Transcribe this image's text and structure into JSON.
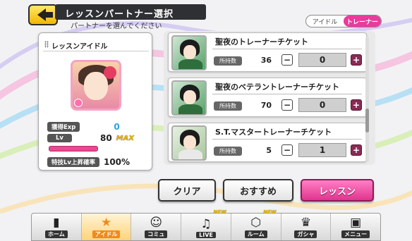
{
  "header": {
    "title": "レッスンパートナー選択",
    "subtitle": "パートナーを選んでください"
  },
  "toggle": {
    "idol_label": "アイドル",
    "trainer_label": "トレーナー",
    "selected": "トレーナー"
  },
  "lesson_idol": {
    "panel_title": "レッスンアイドル",
    "exp_label": "獲得Exp",
    "exp_value": "0",
    "lv_label": "Lv",
    "lv_value": "80",
    "max_label": "MAX",
    "rate_label": "特技Lv上昇確率",
    "rate_value": "100%"
  },
  "tickets": [
    {
      "name": "聖夜のトレーナーチケット",
      "hold_label": "所持数",
      "hold_count": "36",
      "quantity": "0"
    },
    {
      "name": "聖夜のベテラントレーナーチケット",
      "hold_label": "所持数",
      "hold_count": "70",
      "quantity": "0"
    },
    {
      "name": "S.T.マスタートレーナーチケット",
      "hold_label": "所持数",
      "hold_count": "5",
      "quantity": "1"
    }
  ],
  "actions": {
    "clear_label": "クリア",
    "recommend_label": "おすすめ",
    "lesson_label": "レッスン"
  },
  "nav": [
    {
      "label": "ホーム",
      "icon": "home-icon",
      "glyph": "▮",
      "new": ""
    },
    {
      "label": "アイドル",
      "icon": "idol-icon",
      "glyph": "★",
      "new": ""
    },
    {
      "label": "コミュ",
      "icon": "commu-icon",
      "glyph": "☺",
      "new": ""
    },
    {
      "label": "LIVE",
      "icon": "live-icon",
      "glyph": "♫",
      "new": "NEW"
    },
    {
      "label": "ルーム",
      "icon": "room-icon",
      "glyph": "⬡",
      "new": "NEW"
    },
    {
      "label": "ガシャ",
      "icon": "gacha-icon",
      "glyph": "♛",
      "new": ""
    },
    {
      "label": "メニュー",
      "icon": "menu-icon",
      "glyph": "▣",
      "new": ""
    }
  ],
  "colors": {
    "accent_pink": "#e83b9b",
    "exp_blue": "#2e9fe0",
    "max_gold": "#e9b200"
  }
}
